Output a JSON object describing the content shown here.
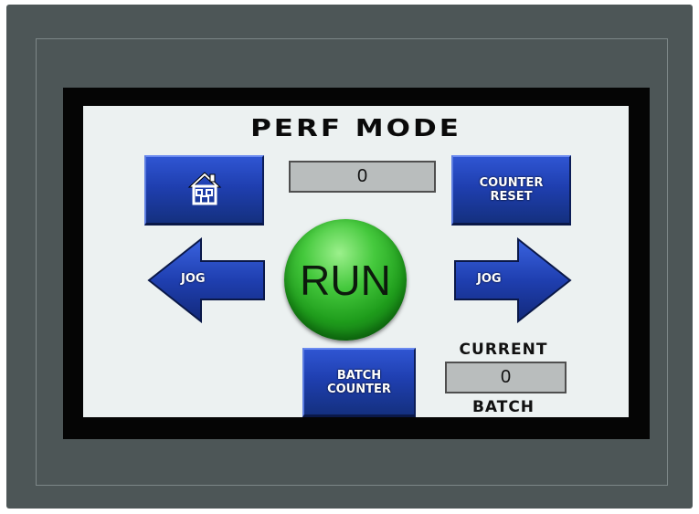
{
  "screen": {
    "title": "PERF MODE"
  },
  "buttons": {
    "home_icon": "house-icon",
    "counter_reset_line1": "COUNTER",
    "counter_reset_line2": "RESET",
    "jog_left": "JOG",
    "jog_right": "JOG",
    "run": "RUN",
    "batch_counter_line1": "BATCH",
    "batch_counter_line2": "COUNTER"
  },
  "displays": {
    "counter_value": "0",
    "current_batch_value": "0"
  },
  "labels": {
    "current": "CURRENT",
    "batch": "BATCH"
  },
  "colors": {
    "button_blue": "#1f3fb0",
    "run_green": "#2fb02a",
    "screen_bg": "#ecf1f1",
    "bezel": "#4d5657"
  }
}
